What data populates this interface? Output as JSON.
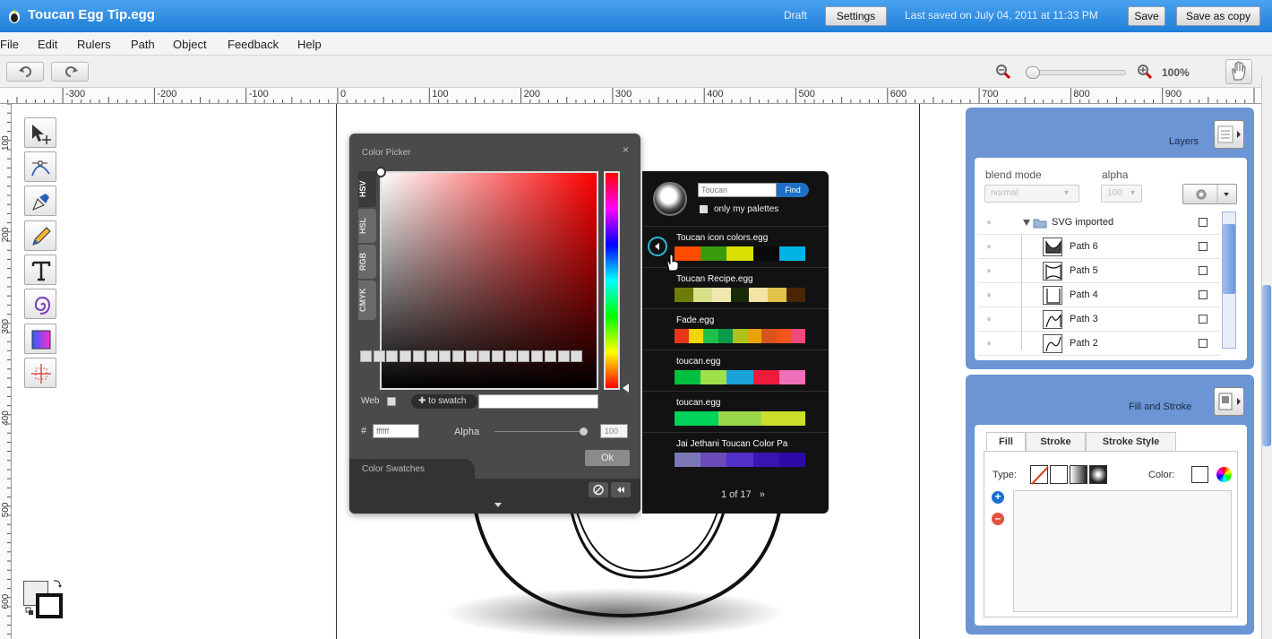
{
  "titlebar": {
    "title": "Toucan Egg Tip.egg",
    "status": "Draft",
    "settings_label": "Settings",
    "saved_text": "Last saved on July 04, 2011 at 11:33 PM",
    "save_label": "Save",
    "save_copy_label": "Save as copy"
  },
  "menu": {
    "items": [
      "File",
      "Edit",
      "Rulers",
      "Path",
      "Object",
      "Feedback",
      "Help"
    ]
  },
  "toolbar": {
    "undo_icon": "undo-icon",
    "redo_icon": "redo-icon",
    "zoom_level": "100%",
    "zoom_fraction": 0.0
  },
  "ruler": {
    "top_labels": [
      "-300",
      "-200",
      "-100",
      "0",
      "100",
      "200",
      "300",
      "400",
      "500",
      "600",
      "700",
      "800",
      "900"
    ],
    "left_labels": [
      "100",
      "200",
      "300",
      "400",
      "500",
      "600"
    ]
  },
  "tools": [
    "select-tool",
    "node-edit-tool",
    "pen-tool",
    "pencil-tool",
    "text-tool",
    "spiral-tool",
    "gradient-tool",
    "transform-tool"
  ],
  "color_picker": {
    "title": "Color Picker",
    "tabs": [
      "HSV",
      "HSL",
      "RGB",
      "CMYK"
    ],
    "active_tab": "HSV",
    "web_label": "Web",
    "to_swatch_label": "to swatch",
    "hex_prefix": "#",
    "hex_value": "ffffff",
    "alpha_label": "Alpha",
    "alpha_value": "100",
    "ok_label": "Ok",
    "swatches_title": "Color Swatches",
    "swatch_count": 17
  },
  "palette_browser": {
    "search_value": "Toucan",
    "find_label": "Find",
    "only_mine_label": "only my palettes",
    "page_text": "1 of 17",
    "palettes": [
      {
        "name": "Toucan icon colors.egg",
        "colors": [
          "#ff4b00",
          "#3a9b0e",
          "#d9e000",
          "#0a0a0a",
          "#00b3e6"
        ]
      },
      {
        "name": "Toucan Recipe.egg",
        "colors": [
          "#6e7d0a",
          "#d8e08a",
          "#efe9b0",
          "#172a0a",
          "#f3e4a5",
          "#e2c24a",
          "#4a2606"
        ]
      },
      {
        "name": "Fade.egg",
        "colors": [
          "#e8361a",
          "#f1d60a",
          "#1fc04a",
          "#0a9a4a",
          "#b0c21a",
          "#e9a40a",
          "#d8541a",
          "#f4531a",
          "#ef4a7a"
        ]
      },
      {
        "name": "toucan.egg",
        "colors": [
          "#00c13f",
          "#9ee04a",
          "#1aa3d9",
          "#ee1a3a",
          "#ef6fb8"
        ]
      },
      {
        "name": "toucan.egg",
        "colors": [
          "#00d35a",
          "#9ad84a",
          "#c9df2a"
        ]
      },
      {
        "name": "Jai Jethani Toucan Color Pa",
        "colors": [
          "#7b78b8",
          "#6b4cb8",
          "#5130c9",
          "#3a14b0",
          "#2e0aa8"
        ]
      }
    ]
  },
  "layers": {
    "title": "Layers",
    "blend_mode_label": "blend mode",
    "alpha_label": "alpha",
    "blend_mode_value": "normal",
    "alpha_value": "100",
    "group_name": "SVG imported",
    "rows": [
      "Path 6",
      "Path 5",
      "Path 4",
      "Path 3",
      "Path 2"
    ]
  },
  "fill_stroke": {
    "title": "Fill and Stroke",
    "tabs": [
      "Fill",
      "Stroke",
      "Stroke Style"
    ],
    "active_tab": "Fill",
    "type_label": "Type:",
    "color_label": "Color:"
  }
}
